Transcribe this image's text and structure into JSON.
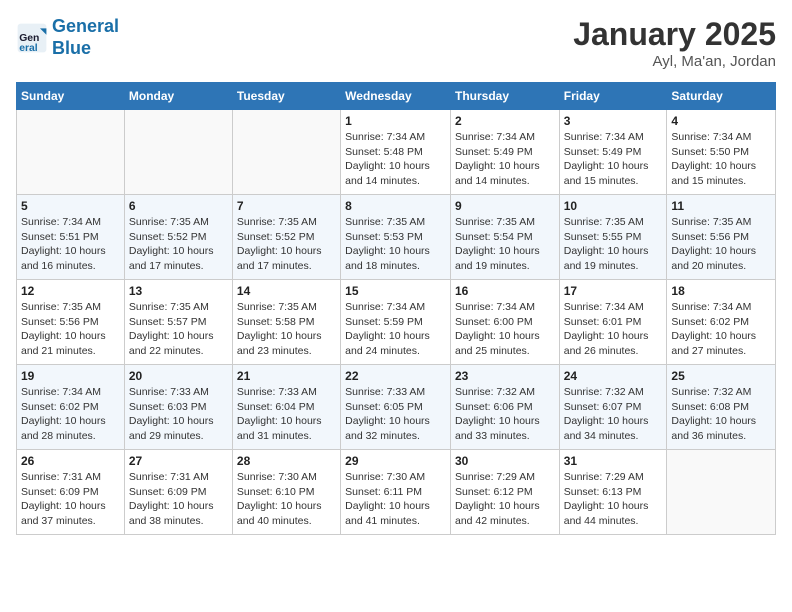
{
  "header": {
    "logo_line1": "General",
    "logo_line2": "Blue",
    "title": "January 2025",
    "subtitle": "Ayl, Ma'an, Jordan"
  },
  "days_of_week": [
    "Sunday",
    "Monday",
    "Tuesday",
    "Wednesday",
    "Thursday",
    "Friday",
    "Saturday"
  ],
  "weeks": [
    [
      {
        "day": "",
        "sunrise": "",
        "sunset": "",
        "daylight": ""
      },
      {
        "day": "",
        "sunrise": "",
        "sunset": "",
        "daylight": ""
      },
      {
        "day": "",
        "sunrise": "",
        "sunset": "",
        "daylight": ""
      },
      {
        "day": "1",
        "sunrise": "Sunrise: 7:34 AM",
        "sunset": "Sunset: 5:48 PM",
        "daylight": "Daylight: 10 hours and 14 minutes."
      },
      {
        "day": "2",
        "sunrise": "Sunrise: 7:34 AM",
        "sunset": "Sunset: 5:49 PM",
        "daylight": "Daylight: 10 hours and 14 minutes."
      },
      {
        "day": "3",
        "sunrise": "Sunrise: 7:34 AM",
        "sunset": "Sunset: 5:49 PM",
        "daylight": "Daylight: 10 hours and 15 minutes."
      },
      {
        "day": "4",
        "sunrise": "Sunrise: 7:34 AM",
        "sunset": "Sunset: 5:50 PM",
        "daylight": "Daylight: 10 hours and 15 minutes."
      }
    ],
    [
      {
        "day": "5",
        "sunrise": "Sunrise: 7:34 AM",
        "sunset": "Sunset: 5:51 PM",
        "daylight": "Daylight: 10 hours and 16 minutes."
      },
      {
        "day": "6",
        "sunrise": "Sunrise: 7:35 AM",
        "sunset": "Sunset: 5:52 PM",
        "daylight": "Daylight: 10 hours and 17 minutes."
      },
      {
        "day": "7",
        "sunrise": "Sunrise: 7:35 AM",
        "sunset": "Sunset: 5:52 PM",
        "daylight": "Daylight: 10 hours and 17 minutes."
      },
      {
        "day": "8",
        "sunrise": "Sunrise: 7:35 AM",
        "sunset": "Sunset: 5:53 PM",
        "daylight": "Daylight: 10 hours and 18 minutes."
      },
      {
        "day": "9",
        "sunrise": "Sunrise: 7:35 AM",
        "sunset": "Sunset: 5:54 PM",
        "daylight": "Daylight: 10 hours and 19 minutes."
      },
      {
        "day": "10",
        "sunrise": "Sunrise: 7:35 AM",
        "sunset": "Sunset: 5:55 PM",
        "daylight": "Daylight: 10 hours and 19 minutes."
      },
      {
        "day": "11",
        "sunrise": "Sunrise: 7:35 AM",
        "sunset": "Sunset: 5:56 PM",
        "daylight": "Daylight: 10 hours and 20 minutes."
      }
    ],
    [
      {
        "day": "12",
        "sunrise": "Sunrise: 7:35 AM",
        "sunset": "Sunset: 5:56 PM",
        "daylight": "Daylight: 10 hours and 21 minutes."
      },
      {
        "day": "13",
        "sunrise": "Sunrise: 7:35 AM",
        "sunset": "Sunset: 5:57 PM",
        "daylight": "Daylight: 10 hours and 22 minutes."
      },
      {
        "day": "14",
        "sunrise": "Sunrise: 7:35 AM",
        "sunset": "Sunset: 5:58 PM",
        "daylight": "Daylight: 10 hours and 23 minutes."
      },
      {
        "day": "15",
        "sunrise": "Sunrise: 7:34 AM",
        "sunset": "Sunset: 5:59 PM",
        "daylight": "Daylight: 10 hours and 24 minutes."
      },
      {
        "day": "16",
        "sunrise": "Sunrise: 7:34 AM",
        "sunset": "Sunset: 6:00 PM",
        "daylight": "Daylight: 10 hours and 25 minutes."
      },
      {
        "day": "17",
        "sunrise": "Sunrise: 7:34 AM",
        "sunset": "Sunset: 6:01 PM",
        "daylight": "Daylight: 10 hours and 26 minutes."
      },
      {
        "day": "18",
        "sunrise": "Sunrise: 7:34 AM",
        "sunset": "Sunset: 6:02 PM",
        "daylight": "Daylight: 10 hours and 27 minutes."
      }
    ],
    [
      {
        "day": "19",
        "sunrise": "Sunrise: 7:34 AM",
        "sunset": "Sunset: 6:02 PM",
        "daylight": "Daylight: 10 hours and 28 minutes."
      },
      {
        "day": "20",
        "sunrise": "Sunrise: 7:33 AM",
        "sunset": "Sunset: 6:03 PM",
        "daylight": "Daylight: 10 hours and 29 minutes."
      },
      {
        "day": "21",
        "sunrise": "Sunrise: 7:33 AM",
        "sunset": "Sunset: 6:04 PM",
        "daylight": "Daylight: 10 hours and 31 minutes."
      },
      {
        "day": "22",
        "sunrise": "Sunrise: 7:33 AM",
        "sunset": "Sunset: 6:05 PM",
        "daylight": "Daylight: 10 hours and 32 minutes."
      },
      {
        "day": "23",
        "sunrise": "Sunrise: 7:32 AM",
        "sunset": "Sunset: 6:06 PM",
        "daylight": "Daylight: 10 hours and 33 minutes."
      },
      {
        "day": "24",
        "sunrise": "Sunrise: 7:32 AM",
        "sunset": "Sunset: 6:07 PM",
        "daylight": "Daylight: 10 hours and 34 minutes."
      },
      {
        "day": "25",
        "sunrise": "Sunrise: 7:32 AM",
        "sunset": "Sunset: 6:08 PM",
        "daylight": "Daylight: 10 hours and 36 minutes."
      }
    ],
    [
      {
        "day": "26",
        "sunrise": "Sunrise: 7:31 AM",
        "sunset": "Sunset: 6:09 PM",
        "daylight": "Daylight: 10 hours and 37 minutes."
      },
      {
        "day": "27",
        "sunrise": "Sunrise: 7:31 AM",
        "sunset": "Sunset: 6:09 PM",
        "daylight": "Daylight: 10 hours and 38 minutes."
      },
      {
        "day": "28",
        "sunrise": "Sunrise: 7:30 AM",
        "sunset": "Sunset: 6:10 PM",
        "daylight": "Daylight: 10 hours and 40 minutes."
      },
      {
        "day": "29",
        "sunrise": "Sunrise: 7:30 AM",
        "sunset": "Sunset: 6:11 PM",
        "daylight": "Daylight: 10 hours and 41 minutes."
      },
      {
        "day": "30",
        "sunrise": "Sunrise: 7:29 AM",
        "sunset": "Sunset: 6:12 PM",
        "daylight": "Daylight: 10 hours and 42 minutes."
      },
      {
        "day": "31",
        "sunrise": "Sunrise: 7:29 AM",
        "sunset": "Sunset: 6:13 PM",
        "daylight": "Daylight: 10 hours and 44 minutes."
      },
      {
        "day": "",
        "sunrise": "",
        "sunset": "",
        "daylight": ""
      }
    ]
  ]
}
